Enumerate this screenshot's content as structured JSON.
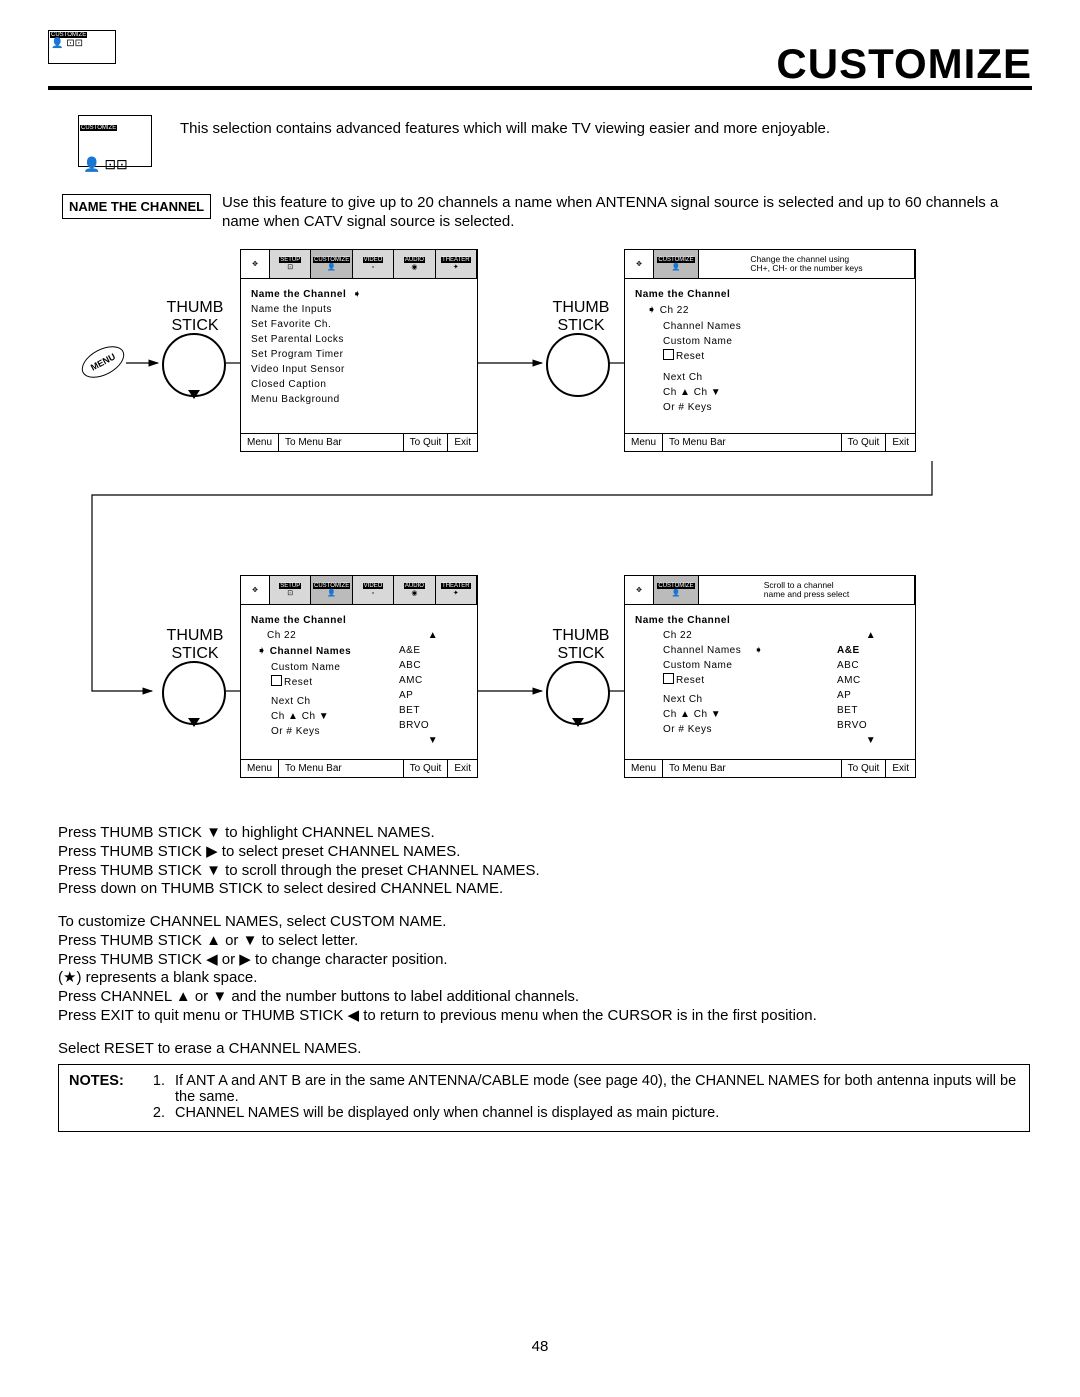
{
  "page_title": "CUSTOMIZE",
  "icon_label": "CUSTOMIZE",
  "intro_text": "This selection contains advanced features which will make TV viewing easier and more enjoyable.",
  "section_label": "NAME THE CHANNEL",
  "section_text": "Use this feature to give up to 20 channels a name when ANTENNA signal source is selected and up to 60 channels a name when CATV signal source is selected.",
  "thumb_stick_label": "THUMB\nSTICK",
  "menu_button": "MENU",
  "tabs": {
    "setup": "SETUP",
    "customize": "CUSTOMIZE",
    "video": "VIDEO",
    "audio": "AUDIO",
    "theater": "THEATER"
  },
  "osd1": {
    "heading": "Name the Channel",
    "items": [
      "Name the Inputs",
      "Set Favorite Ch.",
      "Set Parental Locks",
      "Set Program Timer",
      "Video Input Sensor",
      "Closed Caption",
      "Menu Background"
    ]
  },
  "osd2": {
    "hint": "Change the channel using\nCH+, CH- or the number keys",
    "heading": "Name the Channel",
    "ch": "Ch 22",
    "lines": [
      "Channel Names",
      "Custom Name"
    ],
    "reset": "Reset",
    "next": "Next Ch",
    "chud": "Ch ▲ Ch ▼",
    "keys": "Or # Keys"
  },
  "osd3": {
    "heading": "Name the Channel",
    "ch": "Ch 22",
    "sel": "Channel Names",
    "lines": [
      "Custom Name"
    ],
    "reset": "Reset",
    "next": "Next Ch",
    "chud": "Ch ▲ Ch ▼",
    "keys": "Or # Keys",
    "names": [
      "A&E",
      "ABC",
      "AMC",
      "AP",
      "BET",
      "BRVO"
    ]
  },
  "osd4": {
    "hint": "Scroll to a channel\nname and press select",
    "heading": "Name the Channel",
    "ch": "Ch 22",
    "lines": [
      "Channel Names",
      "Custom Name"
    ],
    "reset": "Reset",
    "next": "Next Ch",
    "chud": "Ch ▲ Ch ▼",
    "keys": "Or # Keys",
    "sel_name": "A&E",
    "names": [
      "ABC",
      "AMC",
      "AP",
      "BET",
      "BRVO"
    ]
  },
  "footer": {
    "menu": "Menu",
    "tobar": "To Menu Bar",
    "toquit": "To Quit",
    "exit": "Exit"
  },
  "instructions": [
    "Press THUMB STICK  ▼ to highlight CHANNEL NAMES.",
    "Press THUMB STICK ▶ to select preset CHANNEL NAMES.",
    "Press THUMB STICK ▼ to scroll through the preset CHANNEL NAMES.",
    "Press down on THUMB STICK to select desired CHANNEL NAME.",
    "",
    "To customize CHANNEL NAMES, select CUSTOM NAME.",
    "Press THUMB STICK ▲ or ▼ to select letter.",
    "Press THUMB STICK ◀ or ▶ to change character position.",
    "(★) represents a blank space.",
    "Press CHANNEL ▲ or ▼  and the number buttons to label additional channels.",
    "Press EXIT to quit menu or THUMB STICK ◀ to return to previous menu when the CURSOR is in the first position.",
    "",
    "Select RESET to erase a CHANNEL NAMES."
  ],
  "notes": {
    "label": "NOTES:",
    "items": [
      "If ANT A and ANT B are in the same ANTENNA/CABLE mode (see page 40), the CHANNEL NAMES for both antenna inputs will be the same.",
      "CHANNEL NAMES will be displayed only when channel is displayed as main picture."
    ]
  },
  "page_number": "48"
}
